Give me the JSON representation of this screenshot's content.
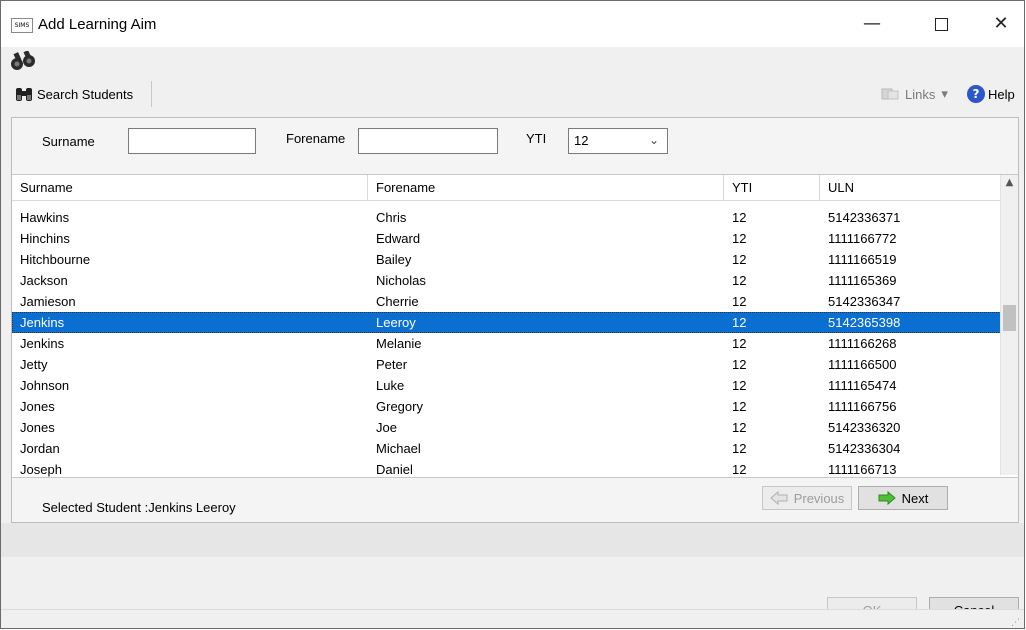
{
  "window": {
    "app_icon_text": "SIMS",
    "title": "Add Learning Aim",
    "minimize": "—",
    "close": "✕"
  },
  "toolbar": {
    "search_students": "Search Students",
    "links": "Links",
    "links_arrow": "▾",
    "help": "Help"
  },
  "search": {
    "surname_label": "Surname",
    "surname_value": "",
    "forename_label": "Forename",
    "forename_value": "",
    "yti_label": "YTI",
    "yti_value": "12"
  },
  "grid": {
    "columns": [
      "Surname",
      "Forename",
      "YTI",
      "ULN"
    ],
    "rows": [
      {
        "surname": "Hawkins",
        "forename": "Chris",
        "yti": "12",
        "uln": "5142336371"
      },
      {
        "surname": "Hinchins",
        "forename": "Edward",
        "yti": "12",
        "uln": "1111166772"
      },
      {
        "surname": "Hitchbourne",
        "forename": "Bailey",
        "yti": "12",
        "uln": "1111166519"
      },
      {
        "surname": "Jackson",
        "forename": "Nicholas",
        "yti": "12",
        "uln": "1111165369"
      },
      {
        "surname": "Jamieson",
        "forename": "Cherrie",
        "yti": "12",
        "uln": "5142336347"
      },
      {
        "surname": "Jenkins",
        "forename": "Leeroy",
        "yti": "12",
        "uln": "5142365398",
        "selected": true
      },
      {
        "surname": "Jenkins",
        "forename": "Melanie",
        "yti": "12",
        "uln": "1111166268"
      },
      {
        "surname": "Jetty",
        "forename": "Peter",
        "yti": "12",
        "uln": "1111166500"
      },
      {
        "surname": "Johnson",
        "forename": "Luke",
        "yti": "12",
        "uln": "1111165474"
      },
      {
        "surname": "Jones",
        "forename": "Gregory",
        "yti": "12",
        "uln": "1111166756"
      },
      {
        "surname": "Jones",
        "forename": "Joe",
        "yti": "12",
        "uln": "5142336320"
      },
      {
        "surname": "Jordan",
        "forename": "Michael",
        "yti": "12",
        "uln": "5142336304"
      },
      {
        "surname": "Joseph",
        "forename": "Daniel",
        "yti": "12",
        "uln": "1111166713"
      }
    ]
  },
  "selection": {
    "text": "Selected Student :Jenkins Leeroy"
  },
  "paging": {
    "previous": "Previous",
    "next": "Next"
  },
  "dialog": {
    "ok": "OK",
    "cancel": "Cancel"
  },
  "colors": {
    "selected_row": "#0a6fd1",
    "help_icon": "#2c56c9"
  }
}
